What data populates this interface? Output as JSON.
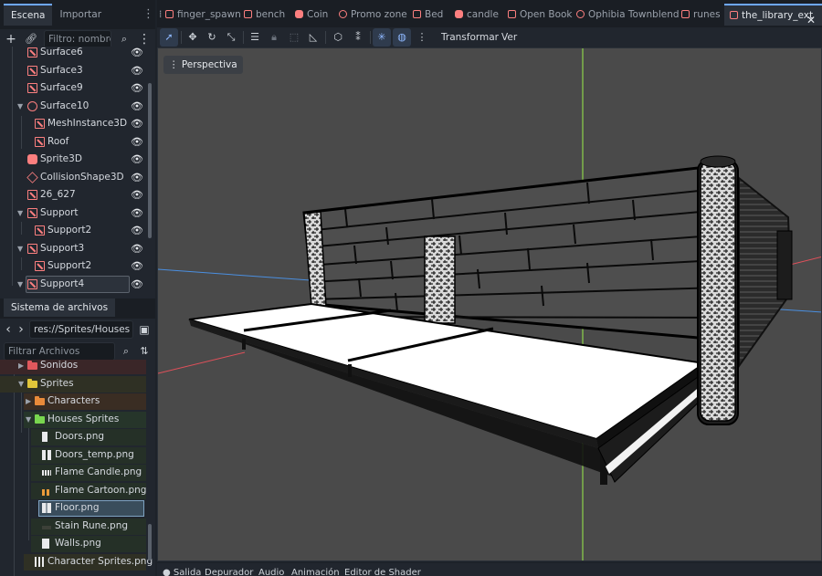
{
  "left_dock": {
    "tabs": [
      "Escena",
      "Importar"
    ],
    "filter_placeholder": "Filtro: nombre, t:",
    "scene_nodes": [
      {
        "label": "Surface6",
        "type": "mesh"
      },
      {
        "label": "Surface3",
        "type": "mesh"
      },
      {
        "label": "Surface9",
        "type": "mesh"
      },
      {
        "label": "Surface10",
        "type": "node"
      },
      {
        "label": "MeshInstance3D",
        "type": "mesh"
      },
      {
        "label": "Roof",
        "type": "mesh"
      },
      {
        "label": "Sprite3D",
        "type": "sprite"
      },
      {
        "label": "CollisionShape3D",
        "type": "collision"
      },
      {
        "label": "26_627",
        "type": "mesh"
      },
      {
        "label": "Support",
        "type": "mesh"
      },
      {
        "label": "Support2",
        "type": "mesh"
      },
      {
        "label": "Support3",
        "type": "mesh"
      },
      {
        "label": "Support2",
        "type": "mesh"
      },
      {
        "label": "Support4",
        "type": "mesh"
      }
    ],
    "filesystem": {
      "tab": "Sistema de archivos",
      "path": "res://Sprites/Houses S",
      "filter_placeholder": "Filtrar Archivos",
      "items": [
        {
          "label": "Sonidos",
          "kind": "folder",
          "color": "#e0585d"
        },
        {
          "label": "Sprites",
          "kind": "folder",
          "color": "#e0c53a"
        },
        {
          "label": "Characters",
          "kind": "folder",
          "color": "#e98a3a"
        },
        {
          "label": "Houses Sprites",
          "kind": "folder",
          "color": "#78d64f"
        },
        {
          "label": "Doors.png",
          "kind": "file"
        },
        {
          "label": "Doors_temp.png",
          "kind": "file"
        },
        {
          "label": "Flame Candle.png",
          "kind": "file"
        },
        {
          "label": "Flame Cartoon.png",
          "kind": "file"
        },
        {
          "label": "Floor.png",
          "kind": "file"
        },
        {
          "label": "Stain Rune.png",
          "kind": "file"
        },
        {
          "label": "Walls.png",
          "kind": "file"
        },
        {
          "label": "Character Sprites.png",
          "kind": "file"
        }
      ]
    }
  },
  "editor_tabs": [
    {
      "label": "finger_spawn",
      "icon": "mesh"
    },
    {
      "label": "bench",
      "icon": "mesh"
    },
    {
      "label": "Coin",
      "icon": "sprite"
    },
    {
      "label": "Promo zone",
      "icon": "node"
    },
    {
      "label": "Bed",
      "icon": "mesh"
    },
    {
      "label": "candle",
      "icon": "sprite"
    },
    {
      "label": "Open Book",
      "icon": "mesh"
    },
    {
      "label": "Ophibia Townblend",
      "icon": "node"
    },
    {
      "label": "runes",
      "icon": "mesh"
    },
    {
      "label": "the_library_ext",
      "icon": "mesh"
    }
  ],
  "viewport_toolbar": {
    "menus": [
      "Transformar",
      "Ver"
    ]
  },
  "viewport": {
    "perspective_label": "Perspectiva"
  },
  "bottom_tabs": [
    "Salida",
    "Depurador",
    "Audio",
    "Animación",
    "Editor de Shader"
  ],
  "colors": {
    "accent": "#6ea7ff",
    "node_icon": "#fc7f7f",
    "viewport_bg": "#4a4a4a",
    "axis_x": "#e0505a",
    "axis_y": "#8ed44a",
    "axis_z": "#4a8fe0"
  }
}
